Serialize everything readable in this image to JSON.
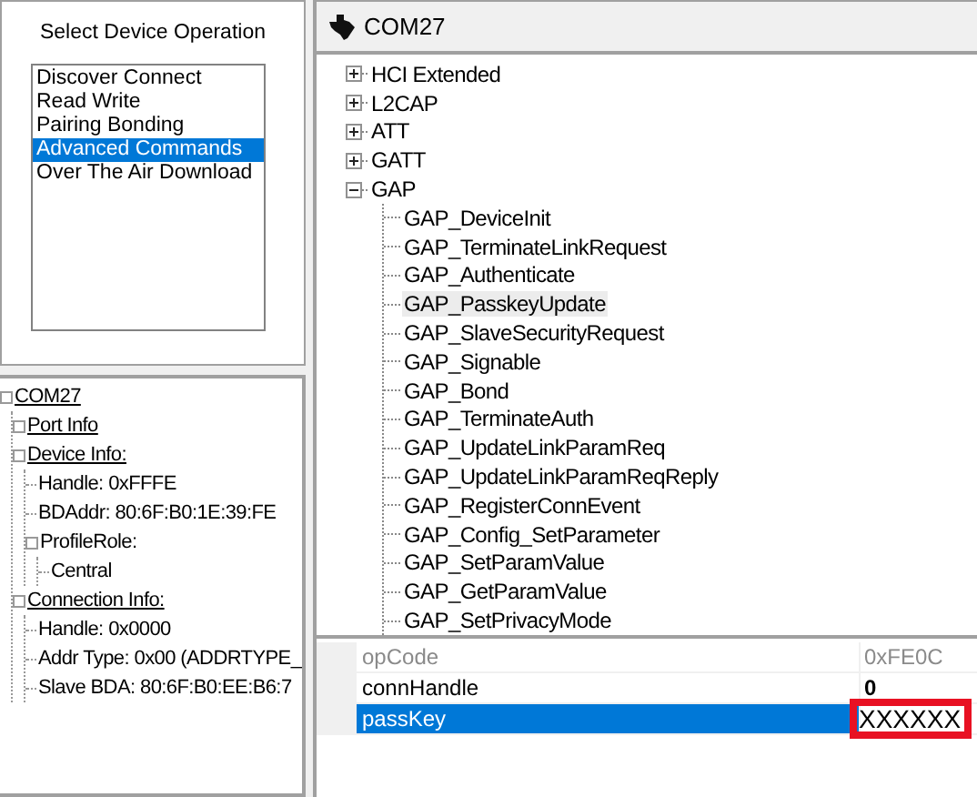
{
  "operation_panel": {
    "title": "Select Device Operation",
    "items": [
      {
        "label": "Discover Connect",
        "selected": false
      },
      {
        "label": "Read Write",
        "selected": false
      },
      {
        "label": "Pairing Bonding",
        "selected": false
      },
      {
        "label": "Advanced Commands",
        "selected": true
      },
      {
        "label": "Over The Air Download",
        "selected": false
      }
    ]
  },
  "device_tree": {
    "label": "COM27",
    "underlined": true,
    "children": [
      {
        "label": "Port Info",
        "underlined": true,
        "expander": true
      },
      {
        "label": "Device Info:",
        "underlined": true,
        "children": [
          {
            "label": "Handle: 0xFFFE"
          },
          {
            "label": "BDAddr: 80:6F:B0:1E:39:FE"
          },
          {
            "label": "ProfileRole:",
            "underlined": false,
            "children": [
              {
                "label": "Central"
              }
            ]
          }
        ]
      },
      {
        "label": "Connection Info:",
        "underlined": true,
        "children": [
          {
            "label": "Handle: 0x0000"
          },
          {
            "label": "Addr Type: 0x00 (ADDRTYPE_"
          },
          {
            "label": "Slave BDA: 80:6F:B0:EE:B6:7"
          }
        ]
      }
    ]
  },
  "header": {
    "title": "COM27"
  },
  "command_tree": [
    {
      "label": "HCI Extended",
      "expanded": false
    },
    {
      "label": "L2CAP",
      "expanded": false
    },
    {
      "label": "ATT",
      "expanded": false
    },
    {
      "label": "GATT",
      "expanded": false
    },
    {
      "label": "GAP",
      "expanded": true,
      "children": [
        {
          "label": "GAP_DeviceInit",
          "selected": false
        },
        {
          "label": "GAP_TerminateLinkRequest",
          "selected": false
        },
        {
          "label": "GAP_Authenticate",
          "selected": false
        },
        {
          "label": "GAP_PasskeyUpdate",
          "selected": true
        },
        {
          "label": "GAP_SlaveSecurityRequest",
          "selected": false
        },
        {
          "label": "GAP_Signable",
          "selected": false
        },
        {
          "label": "GAP_Bond",
          "selected": false
        },
        {
          "label": "GAP_TerminateAuth",
          "selected": false
        },
        {
          "label": "GAP_UpdateLinkParamReq",
          "selected": false
        },
        {
          "label": "GAP_UpdateLinkParamReqReply",
          "selected": false
        },
        {
          "label": "GAP_RegisterConnEvent",
          "selected": false
        },
        {
          "label": "GAP_Config_SetParameter",
          "selected": false
        },
        {
          "label": "GAP_SetParamValue",
          "selected": false
        },
        {
          "label": "GAP_GetParamValue",
          "selected": false
        },
        {
          "label": "GAP_SetPrivacyMode",
          "selected": false
        }
      ]
    }
  ],
  "properties": [
    {
      "name": "opCode",
      "value": "0xFE0C",
      "disabled": true,
      "selected": false,
      "outlined": false
    },
    {
      "name": "connHandle",
      "value": "0",
      "disabled": false,
      "selected": false,
      "outlined": false
    },
    {
      "name": "passKey",
      "value": "XXXXXX",
      "disabled": false,
      "selected": true,
      "outlined": true
    }
  ]
}
